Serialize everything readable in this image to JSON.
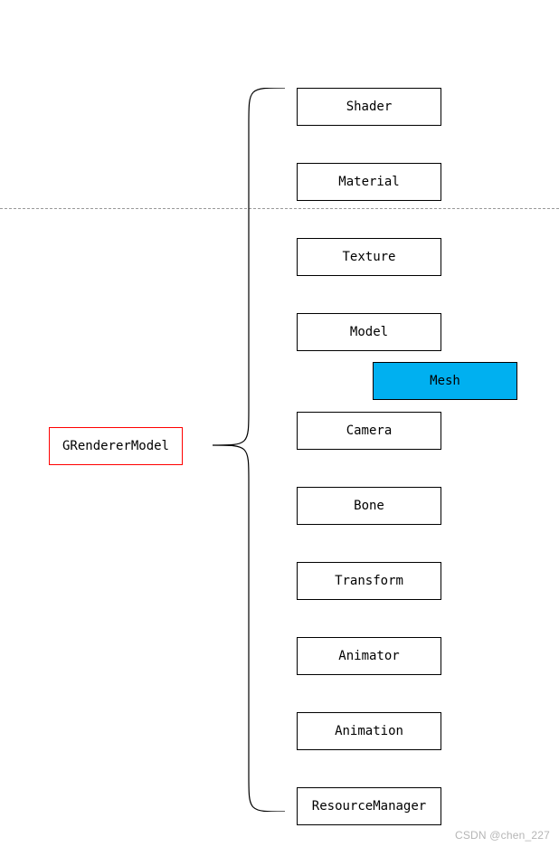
{
  "root": {
    "label": "GRendererModel"
  },
  "children": {
    "shader": {
      "label": "Shader"
    },
    "material": {
      "label": "Material"
    },
    "texture": {
      "label": "Texture"
    },
    "model": {
      "label": "Model"
    },
    "mesh": {
      "label": "Mesh"
    },
    "camera": {
      "label": "Camera"
    },
    "bone": {
      "label": "Bone"
    },
    "transform": {
      "label": "Transform"
    },
    "animator": {
      "label": "Animator"
    },
    "animation": {
      "label": "Animation"
    },
    "resourcemanager": {
      "label": "ResourceManager"
    }
  },
  "watermark": "CSDN @chen_227",
  "colors": {
    "root_border": "#ff0000",
    "child_border": "#000000",
    "mesh_bg": "#00b0f0",
    "dashed": "#999999"
  }
}
